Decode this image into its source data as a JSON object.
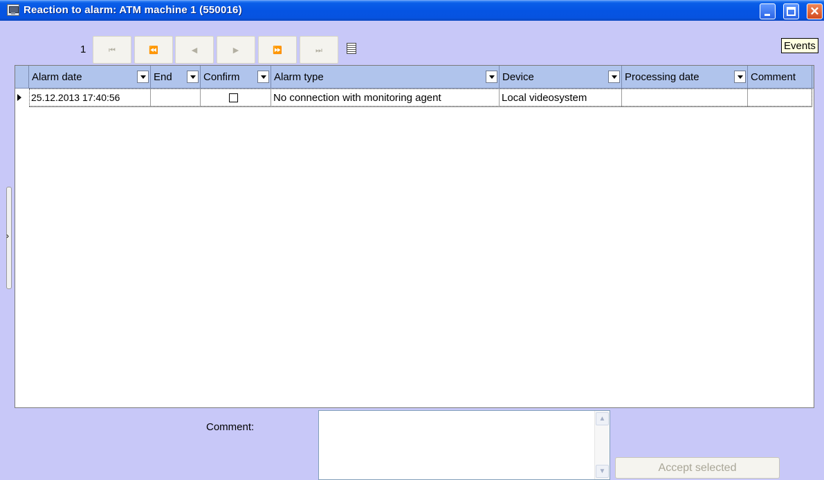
{
  "window": {
    "title": "Reaction to alarm: ATM machine 1 (550016)",
    "icon": "monitor-icon"
  },
  "navigator": {
    "page": "1",
    "buttons": [
      {
        "name": "first",
        "glyph": "⏮"
      },
      {
        "name": "prior-page",
        "glyph": "⏪"
      },
      {
        "name": "prior",
        "glyph": "◀"
      },
      {
        "name": "next",
        "glyph": "▶"
      },
      {
        "name": "next-page",
        "glyph": "⏩"
      },
      {
        "name": "last",
        "glyph": "⏭"
      }
    ],
    "tooltip": "Events"
  },
  "grid": {
    "columns": [
      "Alarm date",
      "End",
      "Confirm",
      "Alarm type",
      "Device",
      "Processing date",
      "Comment"
    ],
    "rows": [
      {
        "alarm_date": "25.12.2013 17:40:56",
        "end": "",
        "confirmed": false,
        "alarm_type": "No connection with monitoring agent",
        "device": "Local videosystem",
        "processing_date": "",
        "comment": ""
      }
    ]
  },
  "footer": {
    "comment_label": "Comment:",
    "comment_value": "",
    "accept_label": "Accept selected"
  },
  "colors": {
    "titlebar": "#0554e3",
    "background": "#c8c8f8",
    "header": "#b0c4ec"
  }
}
